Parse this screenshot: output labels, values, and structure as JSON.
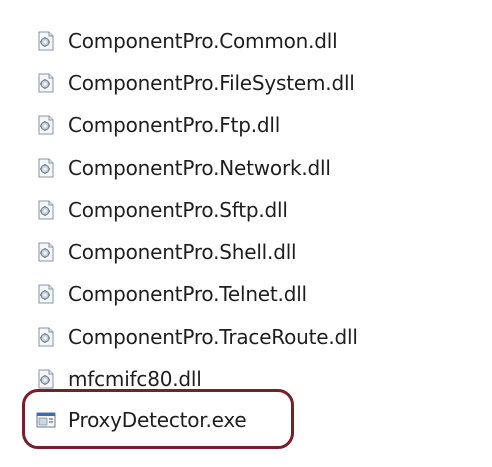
{
  "files": [
    {
      "name": "ComponentPro.Common.dll",
      "icon": "dll-file-icon"
    },
    {
      "name": "ComponentPro.FileSystem.dll",
      "icon": "dll-file-icon"
    },
    {
      "name": "ComponentPro.Ftp.dll",
      "icon": "dll-file-icon"
    },
    {
      "name": "ComponentPro.Network.dll",
      "icon": "dll-file-icon"
    },
    {
      "name": "ComponentPro.Sftp.dll",
      "icon": "dll-file-icon"
    },
    {
      "name": "ComponentPro.Shell.dll",
      "icon": "dll-file-icon"
    },
    {
      "name": "ComponentPro.Telnet.dll",
      "icon": "dll-file-icon"
    },
    {
      "name": "ComponentPro.TraceRoute.dll",
      "icon": "dll-file-icon"
    },
    {
      "name": "mfcmifc80.dll",
      "icon": "dll-file-icon"
    },
    {
      "name": "ProxyDetector.exe",
      "icon": "exe-file-icon"
    }
  ],
  "highlight": {
    "target": "ProxyDetector.exe",
    "color": "#7a1e2c"
  }
}
